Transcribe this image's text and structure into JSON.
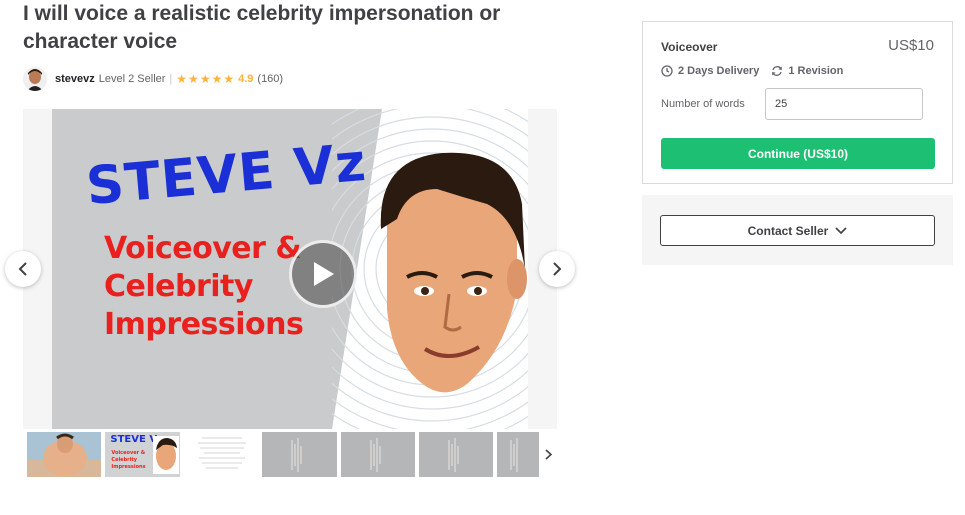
{
  "gig": {
    "title": "I will voice a realistic celebrity impersonation or character voice"
  },
  "seller": {
    "name": "stevevz",
    "level": "Level 2 Seller",
    "separator": "|",
    "rating": "4.9",
    "rating_stars": 5,
    "review_count": "(160)"
  },
  "gallery": {
    "slide": {
      "heading": "STEVE Vz",
      "line1": "Voiceover &",
      "line2": "Celebrity",
      "line3": "Impressions"
    },
    "thumb2": {
      "heading": "STEVE Vz",
      "line1": "Voiceover &",
      "line2": "Celebrity",
      "line3": "Impressions"
    },
    "colors": {
      "heading_blue": "#1a2fd6",
      "text_red": "#e8211e",
      "slide_bg": "#c9cbcc"
    }
  },
  "package": {
    "name": "Voiceover",
    "price": "US$10",
    "delivery": "2 Days Delivery",
    "revisions": "1 Revision",
    "words_label": "Number of words",
    "words_value": "25",
    "continue_label": "Continue (US$10)"
  },
  "contact": {
    "label": "Contact Seller"
  },
  "colors": {
    "accent_green": "#1dbf73",
    "star_yellow": "#ffb33e",
    "text_dark": "#404145"
  }
}
